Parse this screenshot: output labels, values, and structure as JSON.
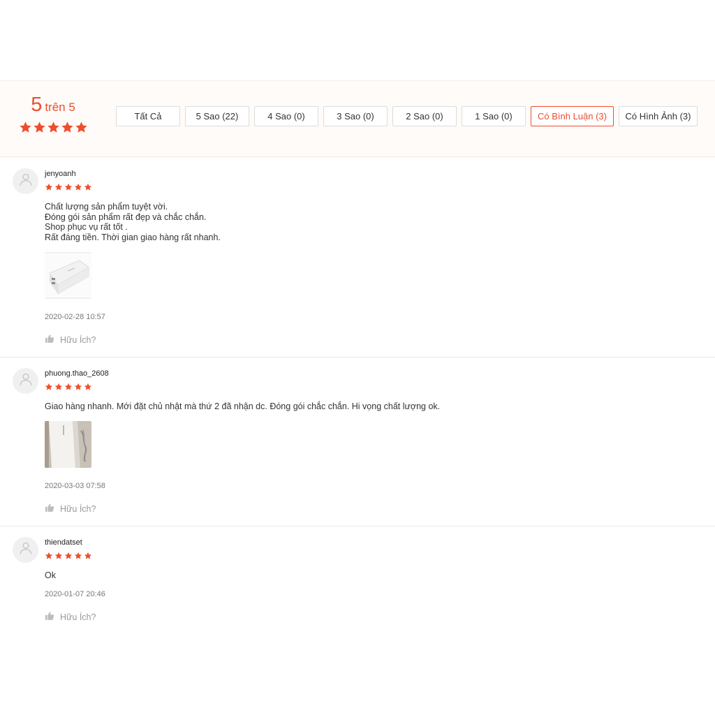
{
  "overview": {
    "score": "5",
    "score_suffix": "trên 5",
    "star_color": "#ee4d2d",
    "filters": [
      {
        "label": "Tất Cả",
        "active": false
      },
      {
        "label": "5 Sao (22)",
        "active": false
      },
      {
        "label": "4 Sao (0)",
        "active": false
      },
      {
        "label": "3 Sao (0)",
        "active": false
      },
      {
        "label": "2 Sao (0)",
        "active": false
      },
      {
        "label": "1 Sao (0)",
        "active": false
      },
      {
        "label": "Có Bình Luận (3)",
        "active": true
      },
      {
        "label": "Có Hình Ảnh (3)",
        "active": false
      }
    ]
  },
  "reviews": [
    {
      "username": "jenyoanh",
      "rating": 5,
      "lines": [
        "Chất lượng sản phẩm tuyệt vời.",
        "Đóng gói sản phẩm rất đẹp và chắc chắn.",
        "Shop phục vụ rất tốt .",
        "Rất đáng tiền. Thời gian giao hàng rất nhanh."
      ],
      "date": "2020-02-28 10:57",
      "helpful_label": "Hữu Ích?"
    },
    {
      "username": "phuong.thao_2608",
      "rating": 5,
      "lines": [
        "Giao hàng nhanh. Mới đặt chủ nhật mà thứ 2 đã nhận dc. Đóng gói chắc chắn. Hi vọng chất lượng ok."
      ],
      "date": "2020-03-03 07:58",
      "helpful_label": "Hữu Ích?"
    },
    {
      "username": "thiendatset",
      "rating": 5,
      "lines": [
        "Ok"
      ],
      "date": "2020-01-07 20:46",
      "helpful_label": "Hữu Ích?"
    }
  ]
}
